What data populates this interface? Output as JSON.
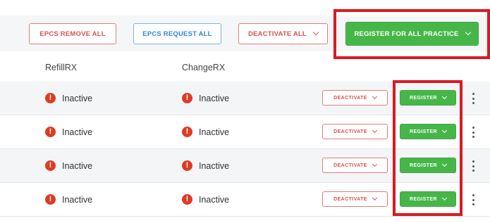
{
  "toolbar": {
    "epcs_remove_all": "EPCS REMOVE ALL",
    "epcs_request_all": "EPCS REQUEST ALL",
    "deactivate_all": "DEACTIVATE ALL",
    "register_all_practice": "REGISTER FOR ALL PRACTICE"
  },
  "columns": {
    "refillrx": "RefillRX",
    "changerx": "ChangeRX"
  },
  "rows": [
    {
      "refill_status": "Inactive",
      "change_status": "Inactive",
      "deactivate": "DEACTIVATE",
      "register": "REGISTER"
    },
    {
      "refill_status": "Inactive",
      "change_status": "Inactive",
      "deactivate": "DEACTIVATE",
      "register": "REGISTER"
    },
    {
      "refill_status": "Inactive",
      "change_status": "Inactive",
      "deactivate": "DEACTIVATE",
      "register": "REGISTER"
    },
    {
      "refill_status": "Inactive",
      "change_status": "Inactive",
      "deactivate": "DEACTIVATE",
      "register": "REGISTER"
    }
  ],
  "icons": {
    "status": "alert-circle-icon",
    "dropdown": "chevron-down-icon",
    "menu": "kebab-menu-icon"
  },
  "colors": {
    "green": "#47b649",
    "red": "#d9534f",
    "blue": "#2f86d6",
    "highlight": "#d91a22",
    "alert": "#dd3b26"
  }
}
